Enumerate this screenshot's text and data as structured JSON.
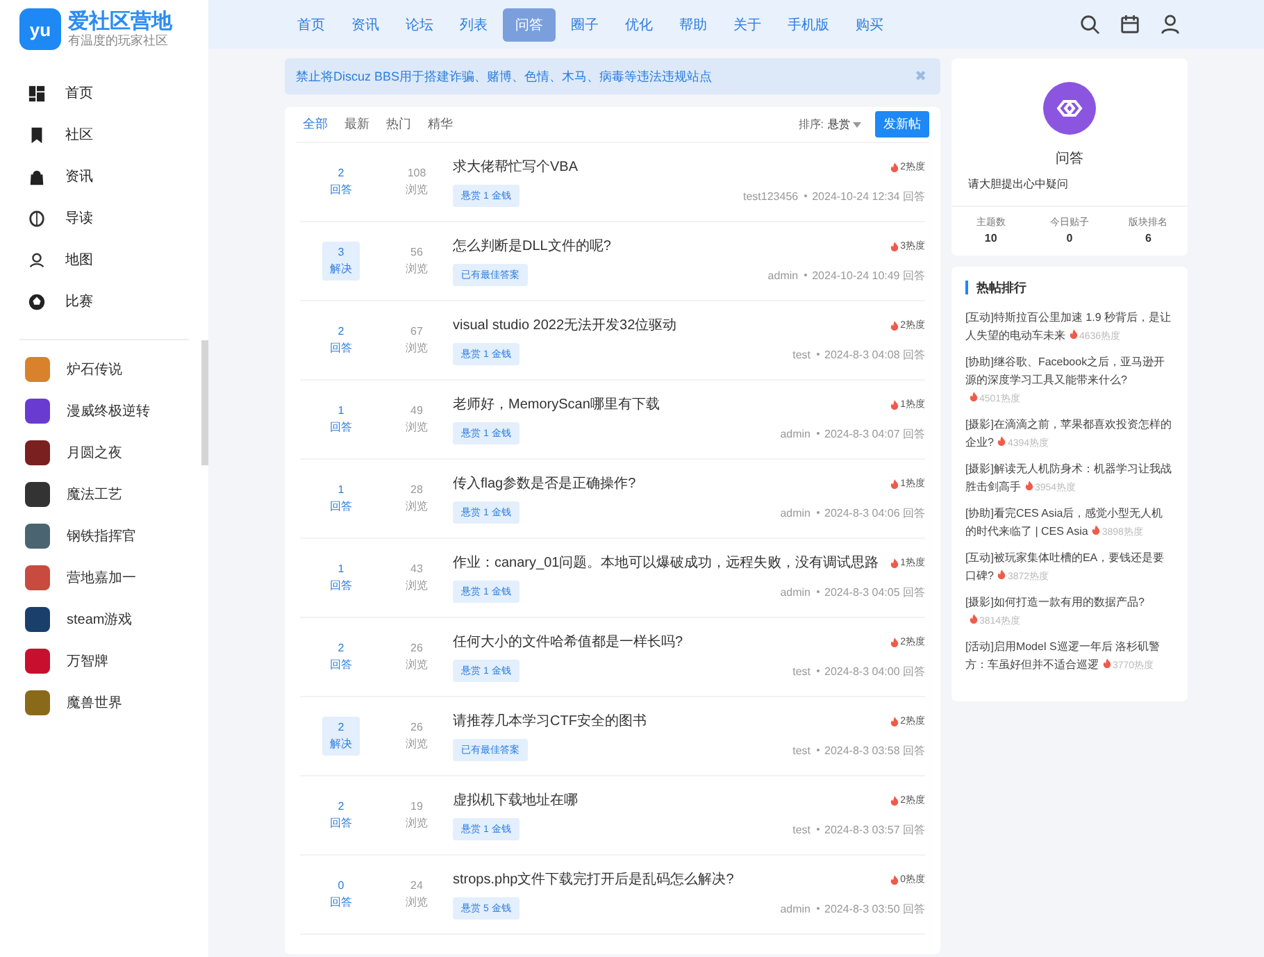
{
  "logo": {
    "mark": "yu",
    "title": "爱社区营地",
    "subtitle": "有温度的玩家社区"
  },
  "sidebar": {
    "nav": [
      "首页",
      "社区",
      "资讯",
      "导读",
      "地图",
      "比赛"
    ],
    "games": [
      "炉石传说",
      "漫威终极逆转",
      "月圆之夜",
      "魔法工艺",
      "钢铁指挥官",
      "营地嘉加一",
      "steam游戏",
      "万智牌",
      "魔兽世界"
    ]
  },
  "topnav": [
    {
      "label": "首页",
      "selected": false
    },
    {
      "label": "资讯",
      "selected": false
    },
    {
      "label": "论坛",
      "selected": false
    },
    {
      "label": "列表",
      "selected": false
    },
    {
      "label": "问答",
      "selected": true
    },
    {
      "label": "圈子",
      "selected": false
    },
    {
      "label": "优化",
      "selected": false
    },
    {
      "label": "帮助",
      "selected": false
    },
    {
      "label": "关于",
      "selected": false
    },
    {
      "label": "手机版",
      "selected": false
    },
    {
      "label": "购买",
      "selected": false
    }
  ],
  "notice": {
    "text": "禁止将Discuz BBS用于搭建诈骗、赌博、色情、木马、病毒等违法违规站点",
    "close": "✖"
  },
  "filters": [
    {
      "label": "全部",
      "selected": true
    },
    {
      "label": "最新",
      "selected": false
    },
    {
      "label": "热门",
      "selected": false
    },
    {
      "label": "精华",
      "selected": false
    }
  ],
  "sort": {
    "label": "排序:",
    "value": "悬赏"
  },
  "new_post_button": "发新帖",
  "threads": [
    {
      "replies": "2",
      "status": "回答",
      "solved": false,
      "views": "108",
      "views_label": "浏览",
      "title": "求大佬帮忙写个VBA",
      "tag": "悬赏 1 金钱",
      "author": "test123456",
      "time": "2024-10-24 12:34",
      "action": "回答",
      "heat": "2热度"
    },
    {
      "replies": "3",
      "status": "解决",
      "solved": true,
      "views": "56",
      "views_label": "浏览",
      "title": "怎么判断是DLL文件的呢?",
      "tag": "已有最佳答案",
      "author": "admin",
      "time": "2024-10-24 10:49",
      "action": "回答",
      "heat": "3热度"
    },
    {
      "replies": "2",
      "status": "回答",
      "solved": false,
      "views": "67",
      "views_label": "浏览",
      "title": "visual studio 2022无法开发32位驱动",
      "tag": "悬赏 1 金钱",
      "author": "test",
      "time": "2024-8-3 04:08",
      "action": "回答",
      "heat": "2热度"
    },
    {
      "replies": "1",
      "status": "回答",
      "solved": false,
      "views": "49",
      "views_label": "浏览",
      "title": "老师好，MemoryScan哪里有下载",
      "tag": "悬赏 1 金钱",
      "author": "admin",
      "time": "2024-8-3 04:07",
      "action": "回答",
      "heat": "1热度"
    },
    {
      "replies": "1",
      "status": "回答",
      "solved": false,
      "views": "28",
      "views_label": "浏览",
      "title": "传入flag参数是否是正确操作?",
      "tag": "悬赏 1 金钱",
      "author": "admin",
      "time": "2024-8-3 04:06",
      "action": "回答",
      "heat": "1热度"
    },
    {
      "replies": "1",
      "status": "回答",
      "solved": false,
      "views": "43",
      "views_label": "浏览",
      "title": "作业：canary_01问题。本地可以爆破成功，远程失败，没有调试思路",
      "tag": "悬赏 1 金钱",
      "author": "admin",
      "time": "2024-8-3 04:05",
      "action": "回答",
      "heat": "1热度"
    },
    {
      "replies": "2",
      "status": "回答",
      "solved": false,
      "views": "26",
      "views_label": "浏览",
      "title": "任何大小的文件哈希值都是一样长吗?",
      "tag": "悬赏 1 金钱",
      "author": "test",
      "time": "2024-8-3 04:00",
      "action": "回答",
      "heat": "2热度"
    },
    {
      "replies": "2",
      "status": "解决",
      "solved": true,
      "views": "26",
      "views_label": "浏览",
      "title": "请推荐几本学习CTF安全的图书",
      "tag": "已有最佳答案",
      "author": "test",
      "time": "2024-8-3 03:58",
      "action": "回答",
      "heat": "2热度"
    },
    {
      "replies": "2",
      "status": "回答",
      "solved": false,
      "views": "19",
      "views_label": "浏览",
      "title": "虚拟机下载地址在哪",
      "tag": "悬赏 1 金钱",
      "author": "test",
      "time": "2024-8-3 03:57",
      "action": "回答",
      "heat": "2热度"
    },
    {
      "replies": "0",
      "status": "回答",
      "solved": false,
      "views": "24",
      "views_label": "浏览",
      "title": "strops.php文件下载完打开后是乱码怎么解决?",
      "tag": "悬赏 5 金钱",
      "author": "admin",
      "time": "2024-8-3 03:50",
      "action": "回答",
      "heat": "0热度"
    }
  ],
  "forum_card": {
    "name": "问答",
    "description": "请大胆提出心中疑问",
    "stats": [
      {
        "label": "主题数",
        "value": "10"
      },
      {
        "label": "今日贴子",
        "value": "0"
      },
      {
        "label": "版块排名",
        "value": "6"
      }
    ]
  },
  "hot_posts": {
    "title": "热帖排行",
    "items": [
      {
        "text": "[互动]特斯拉百公里加速 1.9 秒背后，是让人失望的电动车未来",
        "heat": "4636热度"
      },
      {
        "text": "[协助]继谷歌、Facebook之后，亚马逊开源的深度学习工具又能带来什么?",
        "heat": "4501热度"
      },
      {
        "text": "[摄影]在滴滴之前，苹果都喜欢投资怎样的企业?",
        "heat": "4394热度"
      },
      {
        "text": "[摄影]解读无人机防身术：机器学习让我战胜击剑高手",
        "heat": "3954热度"
      },
      {
        "text": "[协助]看完CES Asia后，感觉小型无人机的时代来临了 | CES Asia",
        "heat": "3898热度"
      },
      {
        "text": "[互动]被玩家集体吐槽的EA，要钱还是要口碑?",
        "heat": "3872热度"
      },
      {
        "text": "[摄影]如何打造一款有用的数据产品?",
        "heat": "3814热度"
      },
      {
        "text": "[活动]启用Model S巡逻一年后 洛杉矶警方：车虽好但并不适合巡逻",
        "heat": "3770热度"
      }
    ]
  }
}
